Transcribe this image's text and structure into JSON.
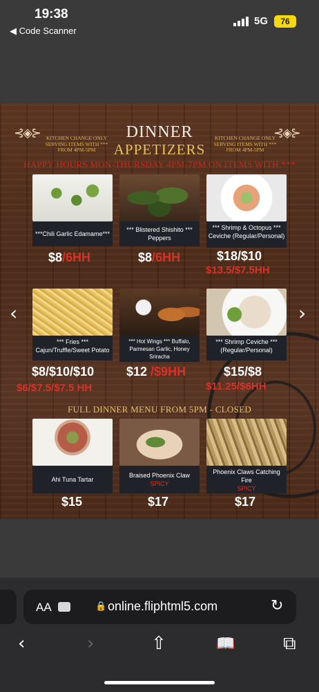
{
  "status_bar": {
    "time": "19:38",
    "back_app": "◀ Code Scanner",
    "network": "5G",
    "battery": "76"
  },
  "menu": {
    "ornament_left": "⊰◈⊱",
    "ornament_right": "⊰◈⊱",
    "title_line1": "DINNER",
    "title_line2": "APPETIZERS",
    "kitchen_notice": "KITCHEN CHANGE ONLY SERVING ITEMS WITH *** FROM 4PM-5PM",
    "happy_hour": "HAPPY HOURS  MON-THURSDAY   4PM-7PM ON ITEMS WITH ***",
    "full_menu_notice": "FULL DINNER MENU FROM 5PM -  CLOSED",
    "items": [
      {
        "name": "***Chili Garlic Edamame***",
        "price": "$8",
        "hh": "/6HH"
      },
      {
        "name": "*** Blistered Shishito *** Peppers",
        "price": "$8",
        "hh": "/6HH"
      },
      {
        "name": "*** Shrimp & Octopus *** Ceviche (Regular/Personal)",
        "price": "$18/$10",
        "price2": "$13.5/$7.5HH"
      },
      {
        "name": "*** Fries *** Cajun/Truffle/Sweet Potato",
        "price": "$8/$10/$10",
        "price2": "$6/$7.5/$7.5 HH"
      },
      {
        "name": "*** Hot Wings *** Buffalo, Parmesan Garlic, Honey Sriracha",
        "price": "$12",
        "hh": " /$9HH"
      },
      {
        "name": "*** Shrimp Ceviche *** (Regular/Personal)",
        "price": "$15/$8",
        "price2": "$11.25/$6HH"
      },
      {
        "name": "Ahi Tuna Tartar",
        "price": "$15"
      },
      {
        "name": "Braised Phoenix Claw",
        "tag": "SPICY",
        "price": "$17"
      },
      {
        "name": "Phoenix Claws Catching Fire",
        "tag": "SPICY",
        "price": "$17"
      }
    ],
    "prev_arrow": "‹",
    "next_arrow": "›"
  },
  "browser": {
    "aa_label": "AA",
    "lock_icon": "🔒",
    "url": "online.fliphtml5.com",
    "reload_icon": "↻",
    "back": "‹",
    "forward": "›",
    "share": "⇧",
    "bookmarks": "📖",
    "tabs": "⧉"
  }
}
